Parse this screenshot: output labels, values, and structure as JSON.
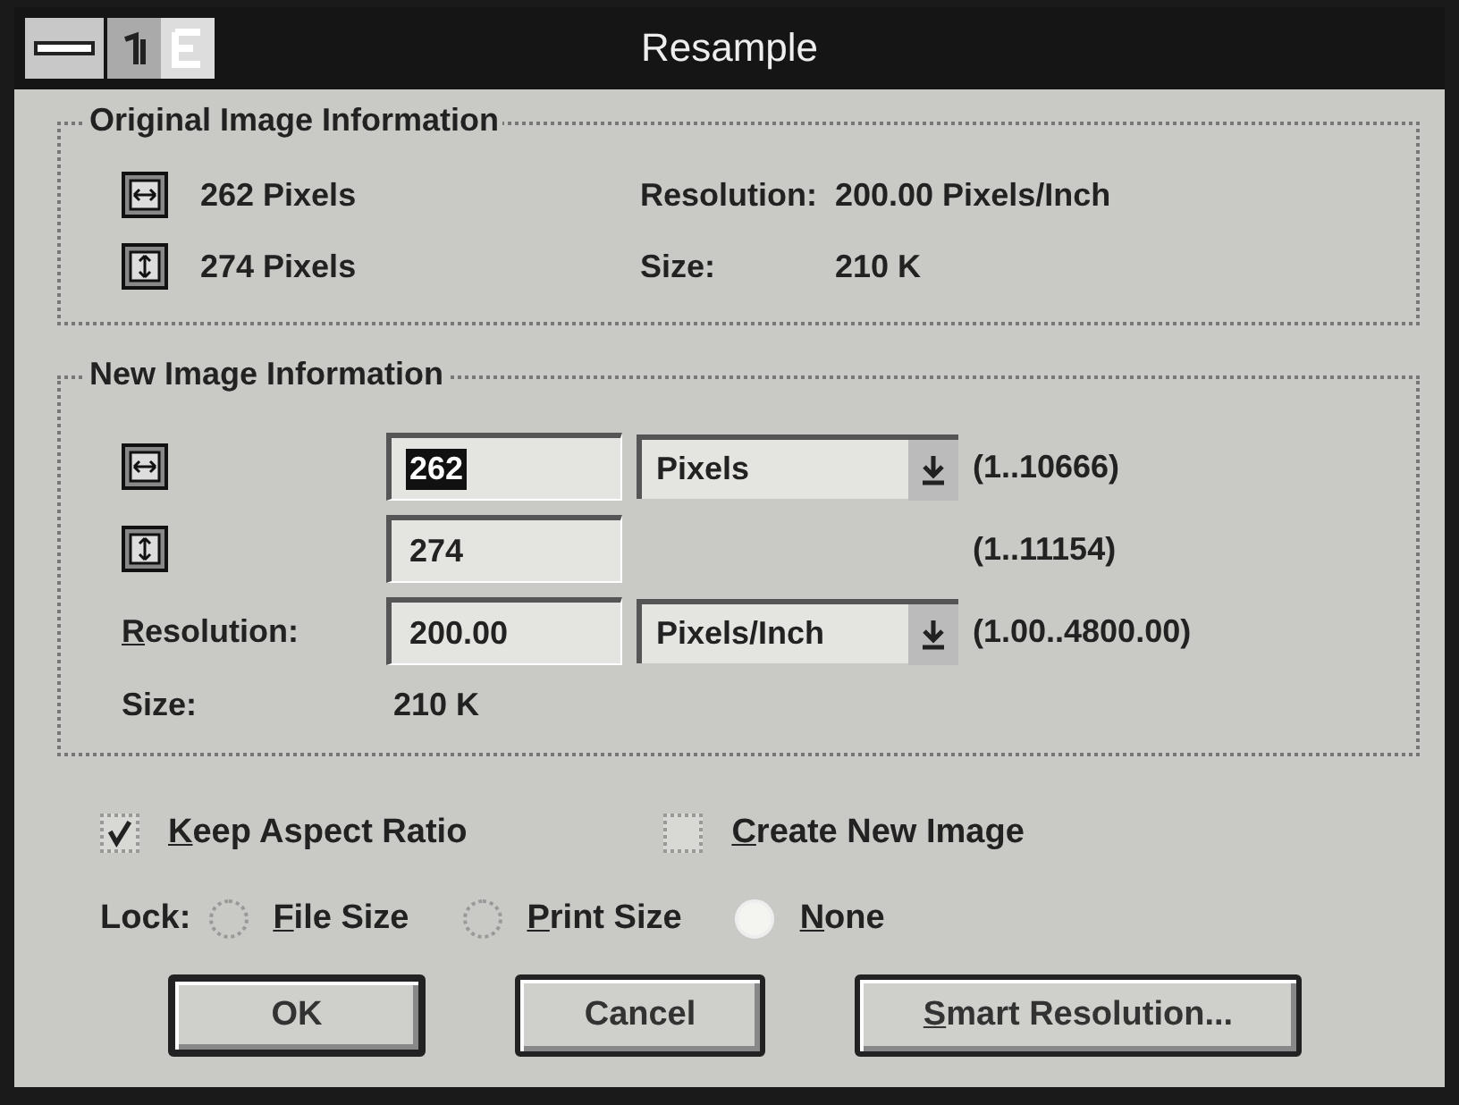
{
  "window": {
    "title": "Resample"
  },
  "original_info": {
    "title": "Original Image Information",
    "width": "262 Pixels",
    "height": "274 Pixels",
    "resolution_label": "Resolution:",
    "resolution": "200.00 Pixels/Inch",
    "size_label": "Size:",
    "size": "210 K"
  },
  "new_info": {
    "title": "New Image Information",
    "rows": [
      {
        "kind": "width",
        "value": "262",
        "selected": true,
        "unit": "Pixels",
        "range": "(1..10666)"
      },
      {
        "kind": "height",
        "value": "274",
        "selected": false,
        "range": "(1..11154)"
      },
      {
        "kind": "resolution",
        "label": "Resolution:",
        "access_key": true,
        "value": "200.00",
        "selected": false,
        "unit": "Pixels/Inch",
        "range": "(1.00..4800.00)"
      }
    ],
    "size_label": "Size:",
    "size": "210 K"
  },
  "options": [
    {
      "label": "Keep Aspect Ratio",
      "checked": true,
      "access_key": true
    },
    {
      "label": "Create New Image",
      "checked": false,
      "access_key": true
    }
  ],
  "lock": {
    "label": "Lock:",
    "options": [
      {
        "label": "File Size",
        "selected": false,
        "access_key": true
      },
      {
        "label": "Print Size",
        "selected": false,
        "access_key": true
      },
      {
        "label": "None",
        "selected": true,
        "access_key": true
      }
    ]
  },
  "buttons": [
    {
      "label": "OK",
      "access_key": false
    },
    {
      "label": "Cancel",
      "access_key": false
    },
    {
      "label": "Smart Resolution...",
      "access_key": true
    }
  ]
}
